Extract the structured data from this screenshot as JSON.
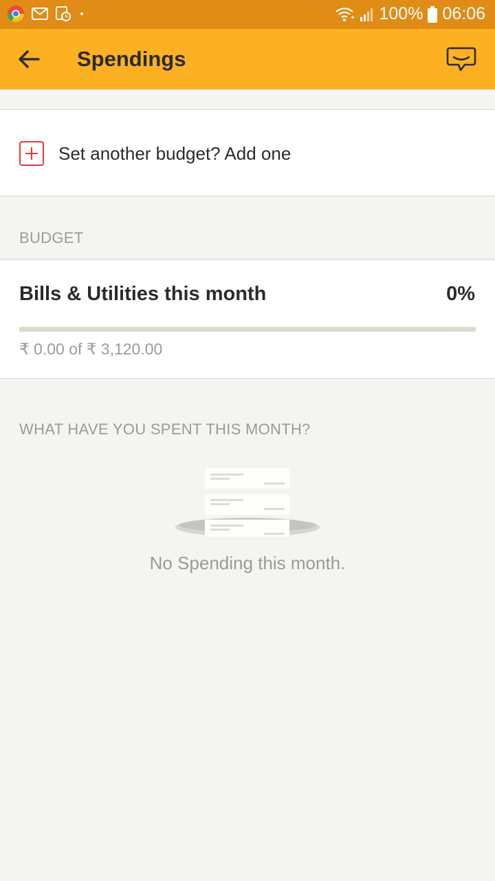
{
  "status_bar": {
    "battery": "100%",
    "time": "06:06"
  },
  "app_bar": {
    "title": "Spendings"
  },
  "add_budget": {
    "label": "Set another budget? Add one"
  },
  "budget_section": {
    "header": "BUDGET",
    "item": {
      "name": "Bills & Utilities this month",
      "percent_label": "0%",
      "progress_fraction": 0,
      "amount_text": "₹ 0.00 of ₹ 3,120.00"
    }
  },
  "spent_section": {
    "header": "WHAT HAVE YOU SPENT THIS MONTH?",
    "empty_message": "No Spending this month."
  },
  "icons": {
    "status_left": [
      "chrome-icon",
      "gmail-icon",
      "screen-recorder-icon",
      "dot-icon"
    ],
    "status_right": [
      "wifi-icon",
      "signal-icon",
      "battery-icon"
    ],
    "app_bar": [
      "back-arrow-icon",
      "chat-icon"
    ],
    "add_budget": "add-icon"
  },
  "colors": {
    "status_bar": "#e08c16",
    "app_bar": "#fdb022",
    "accent_red": "#e53935"
  }
}
